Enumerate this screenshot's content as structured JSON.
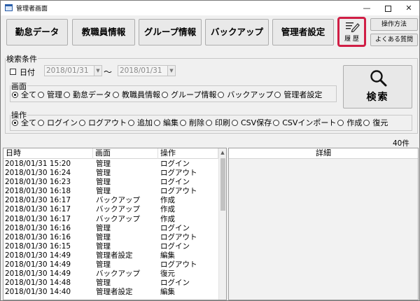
{
  "window": {
    "title": "管理者画面",
    "minimize_glyph": "—",
    "close_glyph": "✕"
  },
  "toolbar": {
    "attendance": "勤怠データ",
    "staff": "教職員情報",
    "group": "グループ情報",
    "backup": "バックアップ",
    "admin": "管理者設定",
    "history": "履 歴",
    "howto": "操作方法",
    "faq": "よくある質問",
    "accent_color": "#d01e45"
  },
  "search": {
    "group_title": "検索条件",
    "date_label": "日付",
    "date_from": "2018/01/31",
    "date_to": "2018/01/31",
    "date_sep": "～",
    "button_label": "検索",
    "screen": {
      "title": "画面",
      "options": [
        "全て",
        "管理",
        "勤怠データ",
        "教職員情報",
        "グループ情報",
        "バックアップ",
        "管理者設定"
      ],
      "selected": "全て"
    },
    "operation": {
      "title": "操作",
      "options": [
        "全て",
        "ログイン",
        "ログアウト",
        "追加",
        "編集",
        "削除",
        "印刷",
        "CSV保存",
        "CSVインポート",
        "作成",
        "復元"
      ],
      "selected": "全て"
    }
  },
  "result_count": "40件",
  "list": {
    "headers": [
      "日時",
      "画面",
      "操作"
    ],
    "rows": [
      [
        "2018/01/31 15:20",
        "管理",
        "ログイン"
      ],
      [
        "2018/01/30 16:24",
        "管理",
        "ログアウト"
      ],
      [
        "2018/01/30 16:23",
        "管理",
        "ログイン"
      ],
      [
        "2018/01/30 16:18",
        "管理",
        "ログアウト"
      ],
      [
        "2018/01/30 16:17",
        "バックアップ",
        "作成"
      ],
      [
        "2018/01/30 16:17",
        "バックアップ",
        "作成"
      ],
      [
        "2018/01/30 16:17",
        "バックアップ",
        "作成"
      ],
      [
        "2018/01/30 16:16",
        "管理",
        "ログイン"
      ],
      [
        "2018/01/30 16:16",
        "管理",
        "ログアウト"
      ],
      [
        "2018/01/30 16:15",
        "管理",
        "ログイン"
      ],
      [
        "2018/01/30 14:49",
        "管理者設定",
        "編集"
      ],
      [
        "2018/01/30 14:49",
        "管理",
        "ログアウト"
      ],
      [
        "2018/01/30 14:49",
        "バックアップ",
        "復元"
      ],
      [
        "2018/01/30 14:48",
        "管理",
        "ログイン"
      ],
      [
        "2018/01/30 14:40",
        "管理者設定",
        "編集"
      ]
    ]
  },
  "detail": {
    "header": "詳細"
  }
}
